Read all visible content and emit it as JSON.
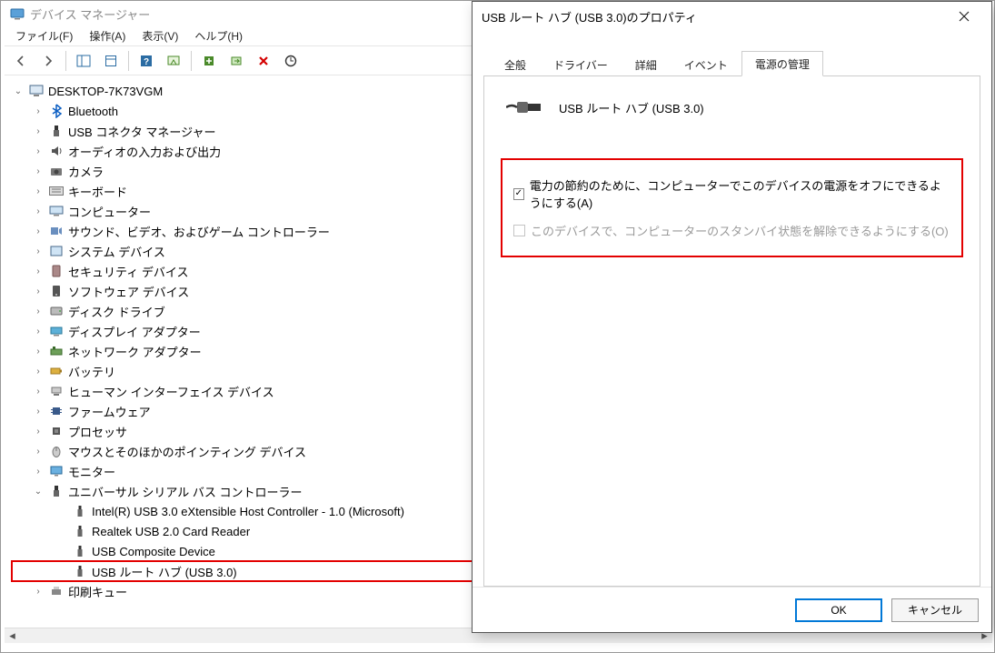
{
  "dm": {
    "title": "デバイス マネージャー",
    "menu": {
      "file": "ファイル(F)",
      "action": "操作(A)",
      "view": "表示(V)",
      "help": "ヘルプ(H)"
    },
    "root": "DESKTOP-7K73VGM",
    "categories": [
      {
        "id": "bluetooth",
        "label": "Bluetooth"
      },
      {
        "id": "usb-connector-mgr",
        "label": "USB コネクタ マネージャー"
      },
      {
        "id": "audio-io",
        "label": "オーディオの入力および出力"
      },
      {
        "id": "camera",
        "label": "カメラ"
      },
      {
        "id": "keyboard",
        "label": "キーボード"
      },
      {
        "id": "computer",
        "label": "コンピューター"
      },
      {
        "id": "sound-video-game",
        "label": "サウンド、ビデオ、およびゲーム コントローラー"
      },
      {
        "id": "system-devices",
        "label": "システム デバイス"
      },
      {
        "id": "security-devices",
        "label": "セキュリティ デバイス"
      },
      {
        "id": "software-devices",
        "label": "ソフトウェア デバイス"
      },
      {
        "id": "disk-drives",
        "label": "ディスク ドライブ"
      },
      {
        "id": "display-adapters",
        "label": "ディスプレイ アダプター"
      },
      {
        "id": "network-adapters",
        "label": "ネットワーク アダプター"
      },
      {
        "id": "battery",
        "label": "バッテリ"
      },
      {
        "id": "hid",
        "label": "ヒューマン インターフェイス デバイス"
      },
      {
        "id": "firmware",
        "label": "ファームウェア"
      },
      {
        "id": "processor",
        "label": "プロセッサ"
      },
      {
        "id": "mouse-pointing",
        "label": "マウスとそのほかのポインティング デバイス"
      },
      {
        "id": "monitor",
        "label": "モニター"
      },
      {
        "id": "usb-controllers",
        "label": "ユニバーサル シリアル バス コントローラー"
      }
    ],
    "usb_children": [
      {
        "id": "xhci",
        "label": "Intel(R) USB 3.0 eXtensible Host Controller - 1.0 (Microsoft)"
      },
      {
        "id": "realtek-reader",
        "label": "Realtek USB 2.0 Card Reader"
      },
      {
        "id": "usb-composite",
        "label": "USB Composite Device"
      },
      {
        "id": "usb-root-hub",
        "label": "USB ルート ハブ (USB 3.0)"
      }
    ],
    "print_queue": "印刷キュー"
  },
  "props": {
    "title": "USB ルート ハブ (USB 3.0)のプロパティ",
    "tabs": {
      "general": "全般",
      "driver": "ドライバー",
      "details": "詳細",
      "events": "イベント",
      "power": "電源の管理"
    },
    "device_name": "USB ルート ハブ (USB 3.0)",
    "chk1": "電力の節約のために、コンピューターでこのデバイスの電源をオフにできるようにする(A)",
    "chk2": "このデバイスで、コンピューターのスタンバイ状態を解除できるようにする(O)",
    "ok": "OK",
    "cancel": "キャンセル"
  }
}
